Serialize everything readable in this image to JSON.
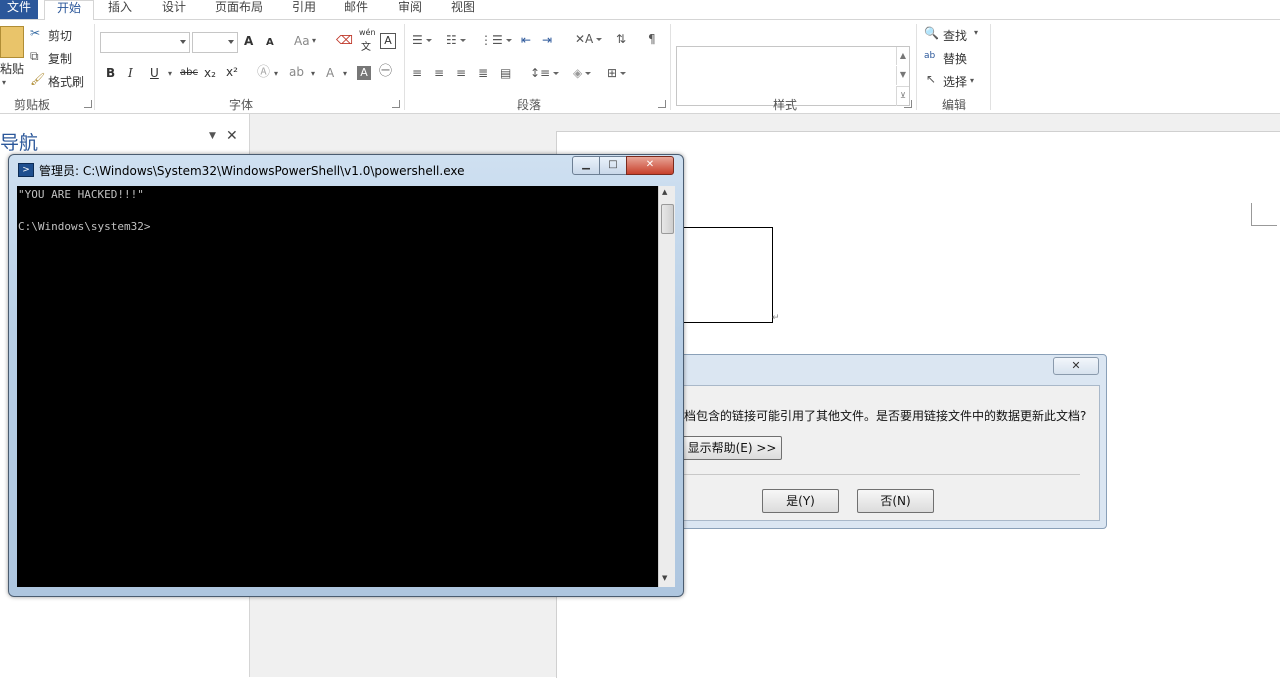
{
  "ribbon": {
    "tabs": [
      "文件",
      "开始",
      "插入",
      "设计",
      "页面布局",
      "引用",
      "邮件",
      "审阅",
      "视图"
    ],
    "active_tab": "开始",
    "clipboard": {
      "paste": "粘贴",
      "cut": "剪切",
      "copy": "复制",
      "format_painter": "格式刷",
      "label": "剪贴板"
    },
    "font": {
      "label": "字体",
      "grow": "A",
      "shrink": "A",
      "case": "Aa",
      "phonetic_top": "wén",
      "phonetic_bottom": "文",
      "bold": "B",
      "italic": "I",
      "underline": "U",
      "strike": "abc",
      "subscript": "x₂",
      "superscript": "x²"
    },
    "paragraph": {
      "label": "段落"
    },
    "styles": {
      "label": "样式"
    },
    "editing": {
      "label": "编辑",
      "find": "查找",
      "replace": "替换",
      "select": "选择"
    }
  },
  "nav": {
    "title": "导航"
  },
  "dialog": {
    "message": "档包含的链接可能引用了其他文件。是否要用链接文件中的数据更新此文档?",
    "help_button": "显示帮助(E) >>",
    "yes_button": "是(Y)",
    "no_button": "否(N)",
    "close_glyph": "✕"
  },
  "powershell": {
    "title": "管理员: C:\\Windows\\System32\\WindowsPowerShell\\v1.0\\powershell.exe",
    "lines": [
      "\"YOU ARE HACKED!!!\"",
      "",
      "C:\\Windows\\system32>"
    ],
    "minimize_glyph": "▁",
    "maximize_glyph": "□",
    "close_glyph": "✕"
  }
}
